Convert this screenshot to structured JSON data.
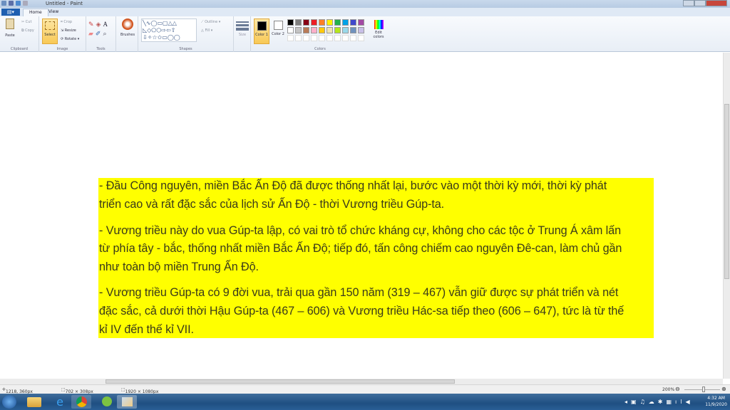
{
  "window": {
    "title": "Untitled - Paint"
  },
  "tabs": [
    {
      "label": "Home"
    },
    {
      "label": "View"
    }
  ],
  "ribbon": {
    "clipboard": {
      "label": "Clipboard",
      "paste": "Paste",
      "cut": "Cut",
      "copy": "Copy"
    },
    "image": {
      "label": "Image",
      "select": "Select",
      "crop": "Crop",
      "resize": "Resize",
      "rotate": "Rotate"
    },
    "tools": {
      "label": "Tools"
    },
    "brushes": "Brushes",
    "shapes": {
      "label": "Shapes",
      "outline": "Outline",
      "fill": "Fill"
    },
    "size": "Size",
    "colors": {
      "label": "Colors",
      "color1": "Color 1",
      "color2": "Color 2",
      "edit": "Edit colors",
      "color1_value": "#000000",
      "color2_value": "#ffffff",
      "palette_row1": [
        "#000000",
        "#7f7f7f",
        "#880015",
        "#ed1c24",
        "#ff7f27",
        "#fff200",
        "#22b14c",
        "#00a2e8",
        "#3f48cc",
        "#a349a4"
      ],
      "palette_row2": [
        "#ffffff",
        "#c3c3c3",
        "#b97a57",
        "#ffaec9",
        "#ffc90e",
        "#efe4b0",
        "#b5e61d",
        "#99d9ea",
        "#7092be",
        "#c8bfe7"
      ]
    }
  },
  "document": {
    "highlight_color": "#ffff00",
    "paragraphs": [
      {
        "lines": [
          "-  Đầu Công nguyên, miền Bắc Ấn Độ đã được thống nhất lại, bước vào một thời kỳ mới, thời kỳ phát",
          "triển cao và rất đặc sắc của lịch sử Ấn Độ - thời Vương triều Gúp-ta."
        ]
      },
      {
        "lines": [
          "-  Vương triều này do vua Gúp-ta lập, có vai trò tổ chức kháng cự, không cho các tộc ở Trung Á xâm lấn",
          "từ phía tây - bắc, thống nhất miền Bắc Ấn Độ; tiếp đó, tấn công chiếm cao nguyên Đê-can, làm chủ gần",
          "như toàn bộ miền Trung Ấn Độ."
        ]
      },
      {
        "lines": [
          "-  Vương triều Gúp-ta có 9 đời vua, trải qua gần 150 năm (319 – 467) vẫn giữ được sự phát triển và nét",
          "đặc sắc, cả dưới thời Hậu Gúp-ta (467 – 606) và Vương triều Hác-sa tiếp theo (606 – 647), tức là từ thế",
          "kỉ IV đến thế kỉ VII."
        ]
      }
    ]
  },
  "status": {
    "cursor": "1218, 360px",
    "selection": "702 × 308px",
    "canvas_size": "1920 × 1080px",
    "zoom": "200%"
  },
  "taskbar": {
    "time": "4:32 AM",
    "date": "11/9/2020"
  }
}
